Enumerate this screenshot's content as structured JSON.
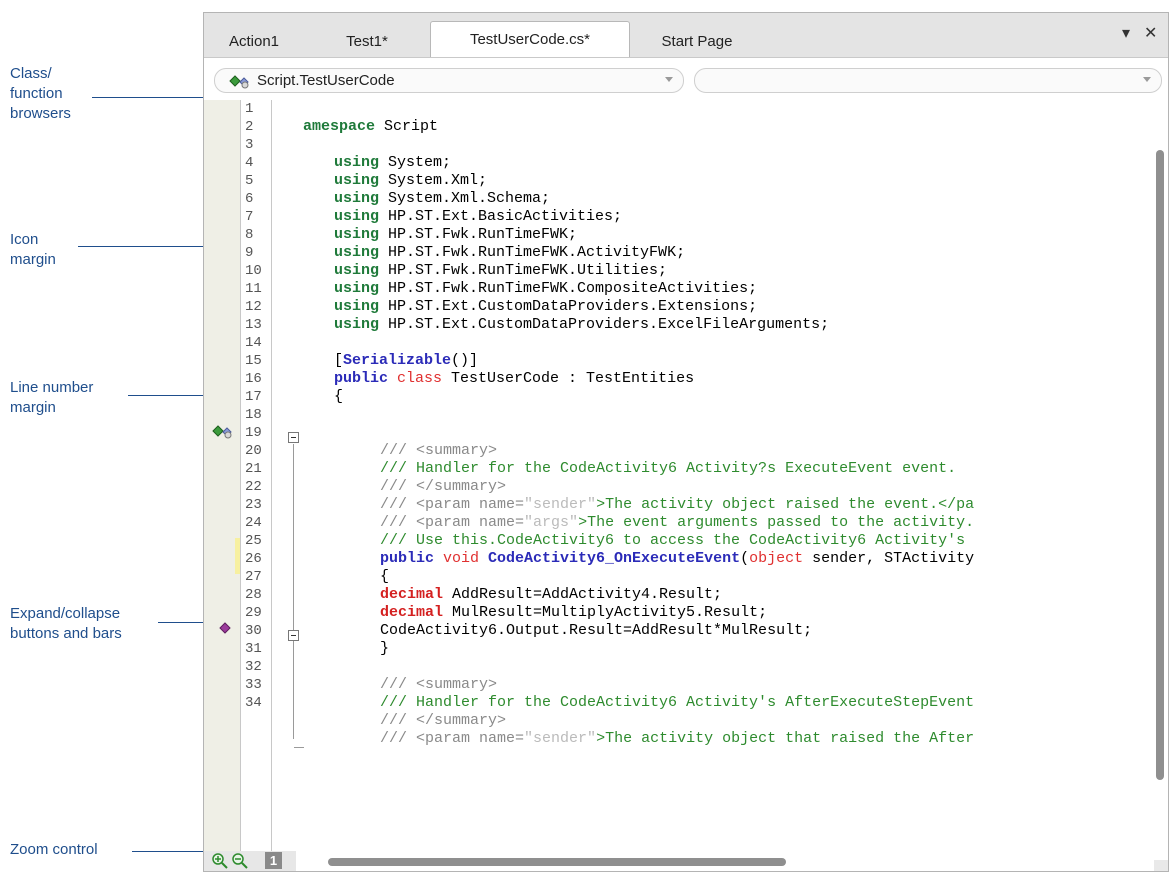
{
  "callouts": [
    {
      "name": "callout-class-function-browsers",
      "l1": "Class/",
      "l2": "function",
      "l3": "browsers"
    },
    {
      "name": "callout-icon-margin",
      "l1": "Icon",
      "l2": "margin"
    },
    {
      "name": "callout-line-number-margin",
      "l1": "Line number",
      "l2": "margin"
    },
    {
      "name": "callout-expand-collapse",
      "l1": "Expand/collapse",
      "l2": "buttons and bars"
    },
    {
      "name": "callout-zoom-control",
      "l1": "Zoom control"
    }
  ],
  "tabs": [
    {
      "label": "Action1"
    },
    {
      "label": "Test1*"
    },
    {
      "label": "TestUserCode.cs*",
      "active": true
    },
    {
      "label": "Start Page"
    }
  ],
  "window_buttons": {
    "pin": "▾",
    "close": "✕"
  },
  "browsers": {
    "class_value": "Script.TestUserCode",
    "member_value": ""
  },
  "line_numbers": [
    "1",
    "2",
    "3",
    "4",
    "5",
    "6",
    "7",
    "8",
    "9",
    "10",
    "11",
    "12",
    "13",
    "14",
    "15",
    "16",
    "17",
    "18",
    "19",
    "20",
    "21",
    "22",
    "23",
    "24",
    "25",
    "26",
    "27",
    "28",
    "29",
    "30",
    "31",
    "32",
    "33",
    "34"
  ],
  "code": {
    "l1_kw": "amespace",
    "l1_rest": " Script",
    "using_kw": "using",
    "usings": [
      " System;",
      " System.Xml;",
      " System.Xml.Schema;",
      " HP.ST.Ext.BasicActivities;",
      " HP.ST.Fwk.RunTimeFWK;",
      " HP.ST.Fwk.RunTimeFWK.ActivityFWK;",
      " HP.ST.Fwk.RunTimeFWK.Utilities;",
      " HP.ST.Fwk.RunTimeFWK.CompositeActivities;",
      " HP.ST.Ext.CustomDataProviders.Extensions;",
      " HP.ST.Ext.CustomDataProviders.ExcelFileArguments;"
    ],
    "l14_open": "[",
    "l14_attr": "Serializable",
    "l14_close": "()]",
    "l15_public": "public",
    "l15_class": " class",
    "l15_rest": " TestUserCode : TestEntities",
    "l16": "{",
    "l18_a": "/// ",
    "l18_b": "<summary>",
    "l19": "/// Handler for the CodeActivity6 Activity?s ExecuteEvent event.",
    "l20_a": "/// ",
    "l20_b": "</summary>",
    "l21_a": "/// ",
    "l21_b": "<param name=",
    "l21_c": "\"sender\"",
    "l21_d": ">The activity object raised the event.</pa",
    "l22_a": "/// ",
    "l22_b": "<param name=",
    "l22_c": "\"args\"",
    "l22_d": ">The event arguments passed to the activity.",
    "l23": "/// Use this.CodeActivity6 to access the CodeActivity6 Activity's",
    "l24_public": "public",
    "l24_void": " void",
    "l24_name": " CodeActivity6_OnExecuteEvent",
    "l24_paren": "(",
    "l24_object": "object",
    "l24_rest": " sender, STActivity",
    "l25": "{",
    "decimal_kw": "decimal",
    "l26_rest": " AddResult=AddActivity4.Result;",
    "l27_rest": " MulResult=MultiplyActivity5.Result;",
    "l28": "CodeActivity6.Output.Result=AddResult*MulResult;",
    "l29": "}",
    "l31_a": "/// ",
    "l31_b": "<summary>",
    "l32": "/// Handler for the CodeActivity6 Activity's AfterExecuteStepEvent",
    "l33_a": "/// ",
    "l33_b": "</summary>",
    "l34_a": "/// ",
    "l34_b": "<param name=",
    "l34_c": "\"sender\"",
    "l34_d": ">The activity object that raised the After"
  },
  "zoom": {
    "value": "1"
  },
  "colors": {
    "callout": "#1f4e8c",
    "keyword_green": "#1f7a3a",
    "keyword_blue": "#2b2bb8",
    "keyword_red": "#d42020",
    "comment": "#2e8b2e"
  }
}
